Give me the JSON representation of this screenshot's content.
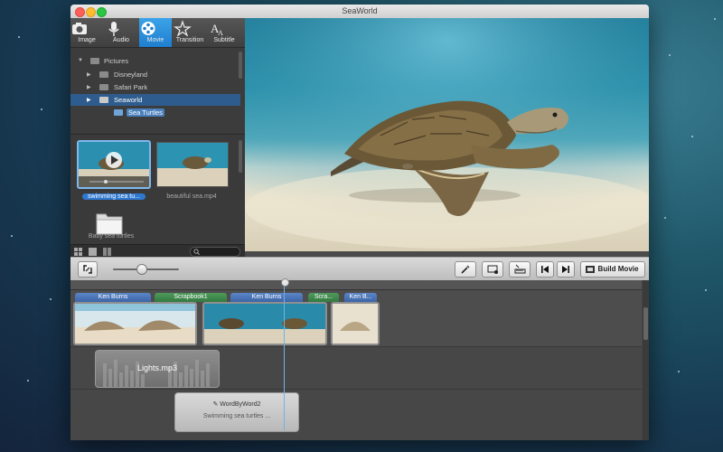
{
  "window": {
    "title": "SeaWorld"
  },
  "tabs": [
    {
      "label": "Image",
      "icon": "camera-icon"
    },
    {
      "label": "Audio",
      "icon": "microphone-icon"
    },
    {
      "label": "Movie",
      "icon": "film-reel-icon",
      "active": true
    },
    {
      "label": "Transition",
      "icon": "transition-star-icon"
    },
    {
      "label": "Subtitle",
      "icon": "subtitle-icon"
    }
  ],
  "tree": {
    "root": "Pictures",
    "items": [
      "Disneyland",
      "Safari Park",
      "Seaworld"
    ],
    "selected": "Seaworld",
    "child": "Sea Turtles"
  },
  "media": {
    "items": [
      {
        "label": "swimming sea tu...",
        "selected": true
      },
      {
        "label": "beautiful sea.mp4",
        "selected": false
      }
    ],
    "folder_label": "Baby sea turtles"
  },
  "toolbar": {
    "build_label": "Build Movie"
  },
  "timeline": {
    "transitions": [
      "Ken Burns",
      "Scrapbook1",
      "Ken Burns",
      "Scra...",
      "Ken B..."
    ],
    "audio_clip": "Lights.mp3",
    "subtitle_clip": {
      "title": "WordByWord2",
      "text": "Swimming sea turtles ..."
    }
  },
  "colors": {
    "accent": "#1f7fcf",
    "selection": "#2e5c8e"
  }
}
